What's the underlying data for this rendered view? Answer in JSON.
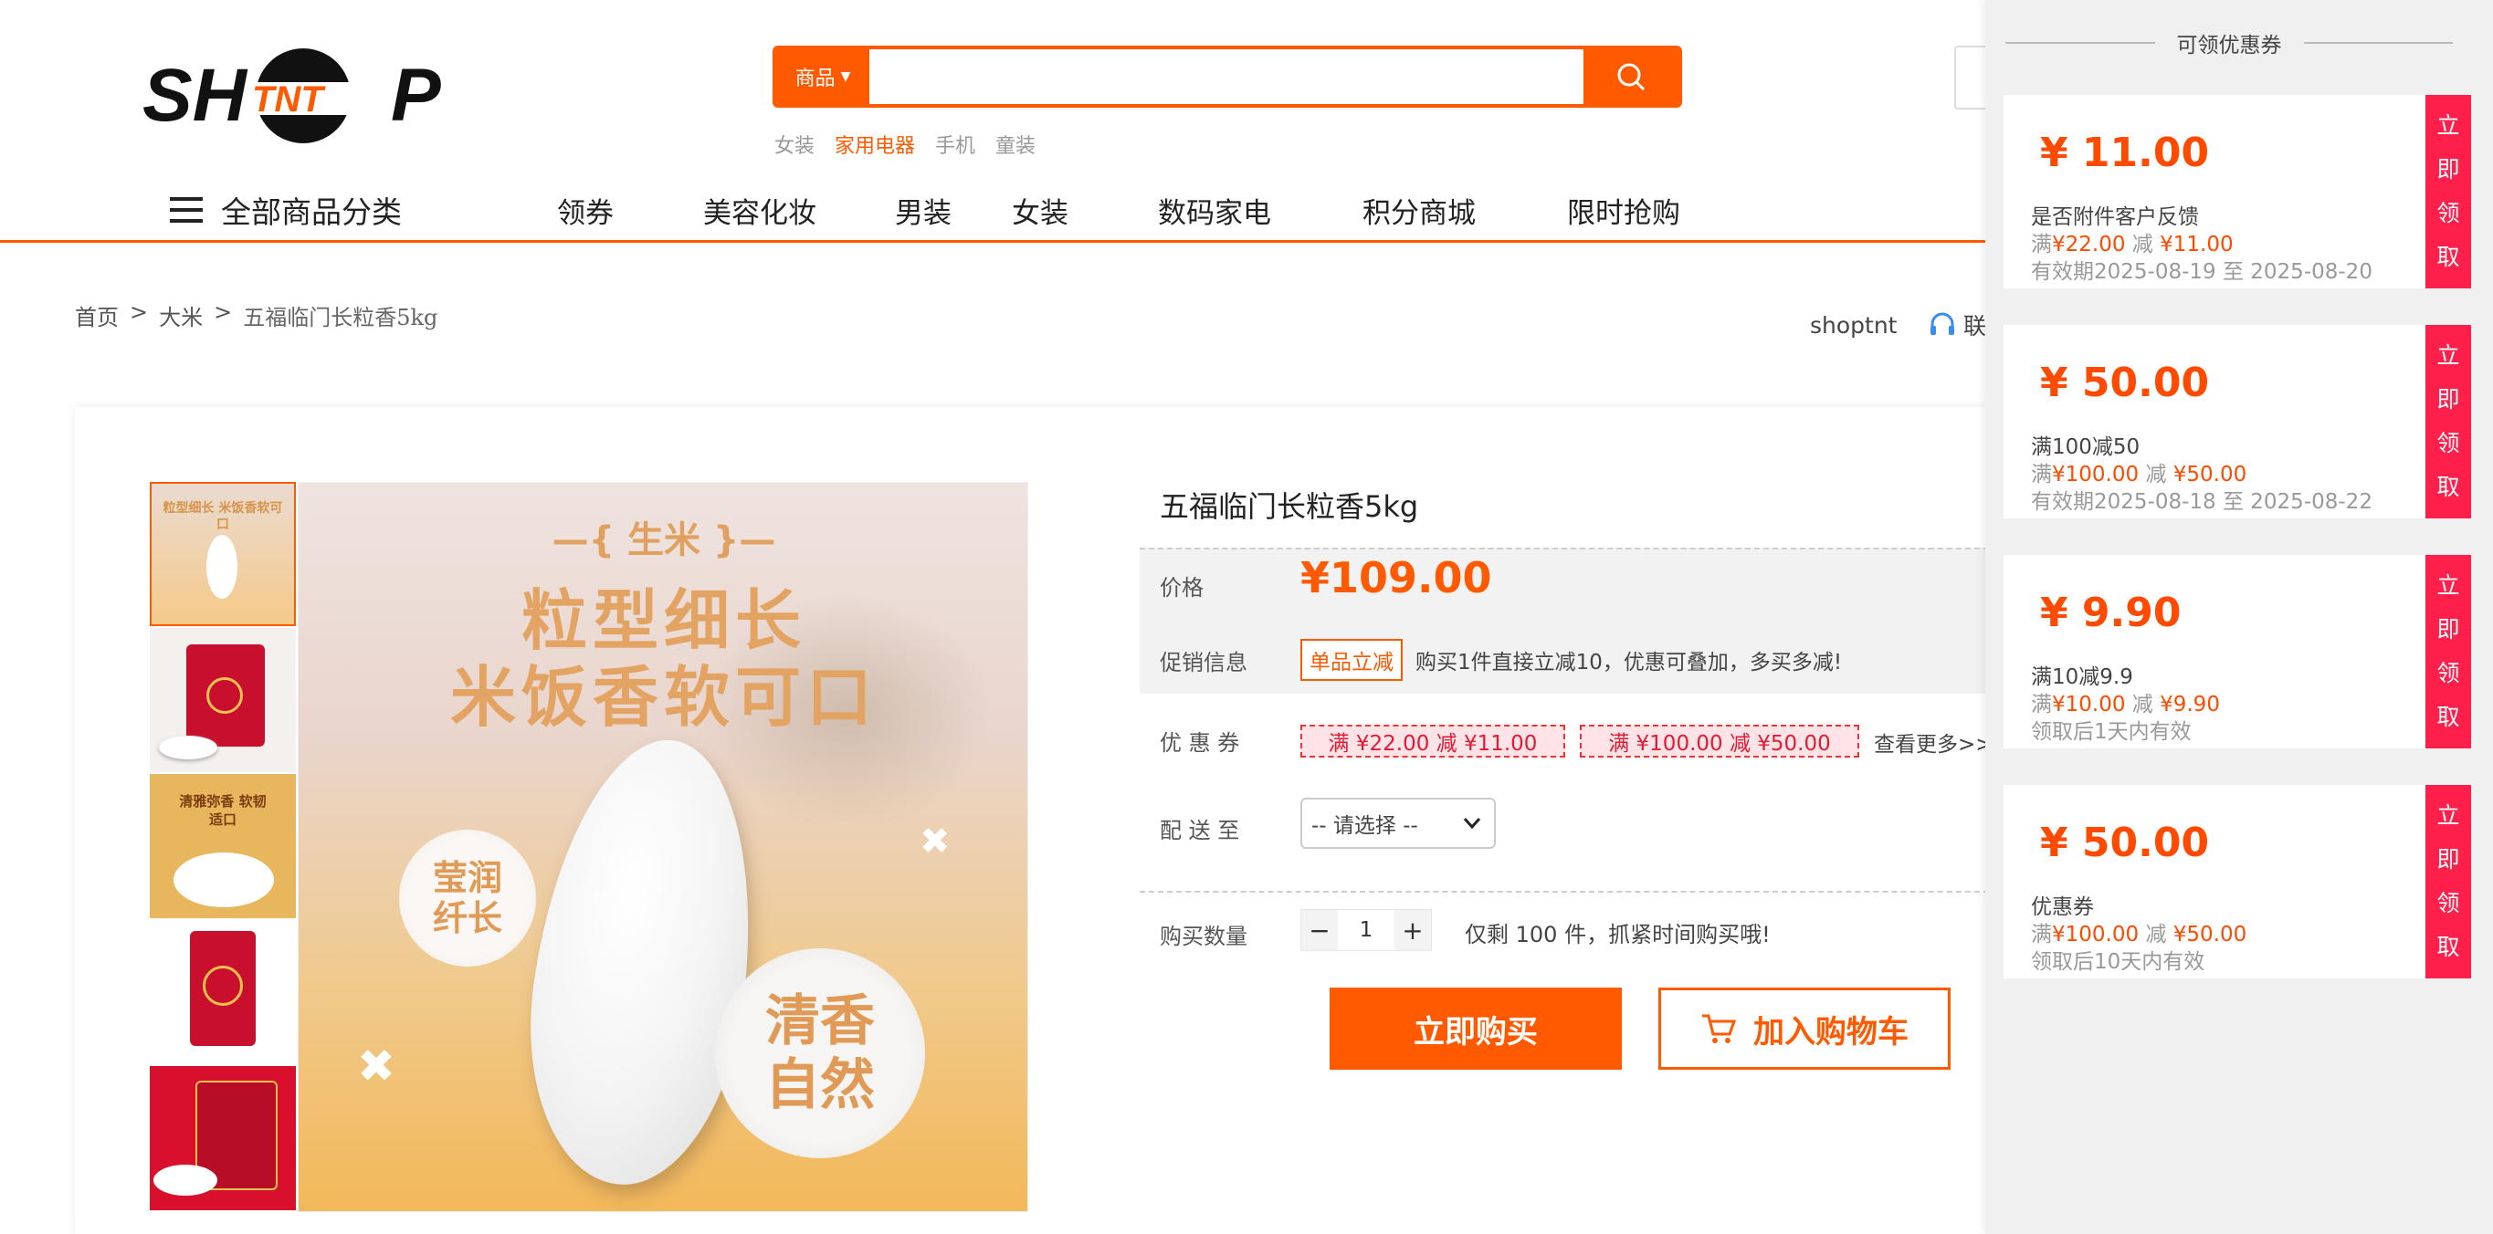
{
  "header": {
    "logo_text": "SHTNTP",
    "search": {
      "category": "商品",
      "value": "",
      "placeholder": ""
    },
    "hot_words": [
      "女装",
      "家用电器",
      "手机",
      "童装"
    ],
    "hot_active_index": 1
  },
  "nav": {
    "all_label": "全部商品分类",
    "items": [
      "领券",
      "美容化妆",
      "男装",
      "女装",
      "数码家电",
      "积分商城",
      "限时抢购"
    ]
  },
  "breadcrumb": [
    "首页",
    ">",
    "大米",
    ">",
    "五福临门长粒香5kg"
  ],
  "shop": {
    "name": "shoptnt",
    "service": "联"
  },
  "product": {
    "title": "五福临门长粒香5kg",
    "image_text": {
      "top": "—{ 生米 }—",
      "line1": "粒型细长",
      "line2": "米饭香软可口",
      "left_badge": "莹润纤长",
      "right_badge": "清香自然"
    },
    "thumb_texts": [
      "粒型细长 米饭香软可口",
      "",
      "清雅弥香 软韧适口",
      "",
      ""
    ],
    "price_label": "价格",
    "price": "¥109.00",
    "promo_label": "促销信息",
    "promo_tag": "单品立减",
    "promo_text": "购买1件直接立减10，优惠可叠加，多买多减!",
    "coupon_label": "优 惠 券",
    "coupons": [
      "满 ¥22.00 减 ¥11.00",
      "满 ¥100.00 减 ¥50.00"
    ],
    "more": "查看更多>>",
    "ship_label": "配 送 至",
    "ship_select": "-- 请选择 --",
    "qty_label": "购买数量",
    "qty": "1",
    "qty_minus": "−",
    "qty_plus": "+",
    "stock_text": "仅剩 100 件，抓紧时间购买哦!",
    "buy_label": "立即购买",
    "cart_label": "加入购物车"
  },
  "coupon_panel": {
    "title": "可领优惠券",
    "get_label": "立即领取",
    "items": [
      {
        "amount": "¥ 11.00",
        "name": "是否附件客户反馈",
        "cond_pre": "满",
        "full": "¥22.00",
        "cond_mid": "减",
        "off": "¥11.00",
        "valid": "有效期2025-08-19 至 2025-08-20"
      },
      {
        "amount": "¥ 50.00",
        "name": "满100减50",
        "cond_pre": "满",
        "full": "¥100.00",
        "cond_mid": "减",
        "off": "¥50.00",
        "valid": "有效期2025-08-18 至 2025-08-22"
      },
      {
        "amount": "¥ 9.90",
        "name": "满10减9.9",
        "cond_pre": "满",
        "full": "¥10.00",
        "cond_mid": "减",
        "off": "¥9.90",
        "valid": "领取后1天内有效"
      },
      {
        "amount": "¥ 50.00",
        "name": "优惠券",
        "cond_pre": "满",
        "full": "¥100.00",
        "cond_mid": "减",
        "off": "¥50.00",
        "valid": "领取后10天内有效"
      }
    ]
  },
  "colors": {
    "accent": "#ff5a00",
    "coupon_red": "#ff1f4b"
  }
}
